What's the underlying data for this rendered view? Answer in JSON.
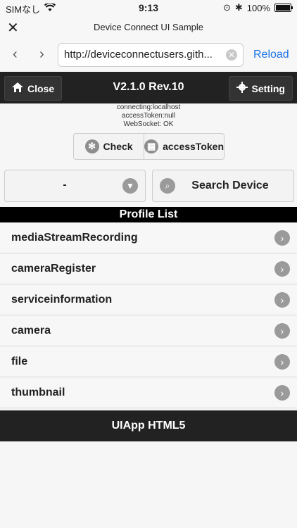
{
  "statusbar": {
    "carrier": "SIMなし",
    "time": "9:13",
    "battery": "100%"
  },
  "titlebar": {
    "title": "Device Connect UI Sample"
  },
  "urlbar": {
    "url": "http://deviceconnectusers.gith...",
    "reload": "Reload"
  },
  "header": {
    "close_label": "Close",
    "version": "V2.1.0 Rev.10",
    "setting_label": "Setting"
  },
  "status": {
    "connecting": "connecting:localhost",
    "token": "accessToken:null",
    "websocket": "WebSocket: OK"
  },
  "actions": {
    "check_label": "Check",
    "token_label": "accessToken"
  },
  "device": {
    "selected": "-",
    "search_label": "Search Device"
  },
  "profile": {
    "title": "Profile List",
    "items": [
      {
        "label": "mediaStreamRecording"
      },
      {
        "label": "cameraRegister"
      },
      {
        "label": "serviceinformation"
      },
      {
        "label": "camera"
      },
      {
        "label": "file"
      },
      {
        "label": "thumbnail"
      }
    ]
  },
  "footer": {
    "label": "UIApp HTML5"
  }
}
